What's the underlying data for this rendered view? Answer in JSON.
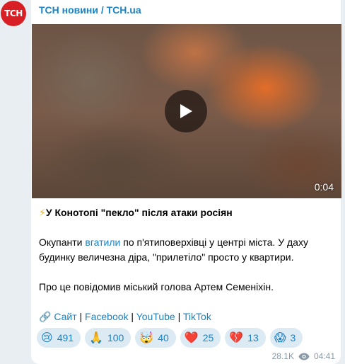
{
  "channel": {
    "avatar_text": "ТСН",
    "name": "ТСН новини / TCH.ua"
  },
  "video": {
    "duration": "0:04"
  },
  "post": {
    "headline_emoji": "⚡",
    "headline": "У Конотопі \"пекло\" після атаки росіян",
    "p1_before": "Окупанти ",
    "p1_link": "вгатили",
    "p1_after": " по п'ятиповерхівці у центрі міста. У даху будинку величезна діра, \"прилетіло\" просто у квартири.",
    "p2": "Про це повідомив міський голова Артем Семеніхін.",
    "links_emoji": "🔗",
    "links": [
      "Сайт",
      "Facebook",
      "YouTube",
      "TikTok"
    ],
    "separator": " | "
  },
  "reactions": [
    {
      "icon": "crying-face-icon",
      "emoji": "😢",
      "count": "491"
    },
    {
      "icon": "praying-hands-icon",
      "emoji": "🙏",
      "count": "100"
    },
    {
      "icon": "exploding-head-icon",
      "emoji": "🤯",
      "count": "40"
    },
    {
      "icon": "red-heart-icon",
      "emoji": "❤️",
      "count": "25"
    },
    {
      "icon": "broken-heart-icon",
      "emoji": "💔",
      "count": "13"
    },
    {
      "icon": "screaming-face-icon",
      "emoji": "😱",
      "count": "3"
    }
  ],
  "meta": {
    "views": "28.1K",
    "time": "04:41"
  },
  "colors": {
    "accent": "#1b82c3",
    "avatar": "#d81f26",
    "reaction_bg": "#dceaf4"
  }
}
